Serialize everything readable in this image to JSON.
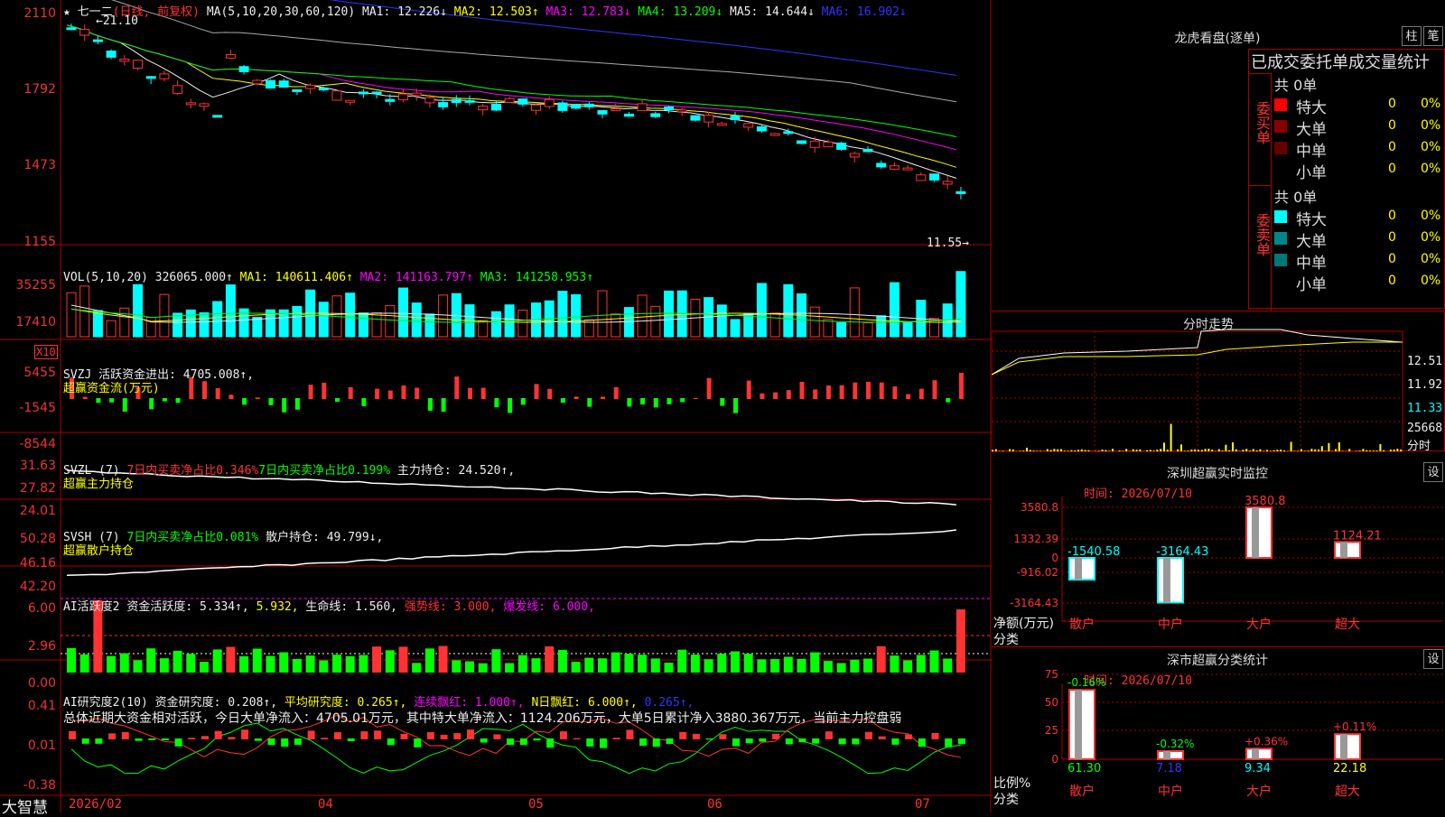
{
  "app": {
    "brand": "大智慧"
  },
  "main": {
    "title": "七一二",
    "period": "(日线, 前复权)",
    "ma_label": "MA(5,10,20,30,60,120)",
    "ma1": "MA1: 12.226↓",
    "ma2": "MA2: 12.503↑",
    "ma3": "MA3: 12.783↓",
    "ma4": "MA4: 13.209↓",
    "ma5": "MA5: 14.644↓",
    "ma6": "MA6: 16.902↓",
    "y_ticks": [
      "2110",
      "1792",
      "1473",
      "1155"
    ],
    "high_label": "21.10",
    "low_label": "11.55"
  },
  "vol": {
    "label": "VOL(5,10,20)",
    "value": "326065.000↑",
    "ma1": "MA1: 140611.406↑",
    "ma2": "MA2: 141163.797↑",
    "ma3": "MA3: 141258.953↑",
    "y_ticks": [
      "35255",
      "17410"
    ],
    "unit": "X10"
  },
  "svzj": {
    "label": "SVZJ",
    "line": "活跃资金进出: 4705.008↑,",
    "sub": "超赢资金流(万元)",
    "y_ticks": [
      "5455",
      "-1545",
      "-8544"
    ]
  },
  "svzl": {
    "label": "SVZL (7)",
    "a": "7日内买卖净占比0.346%",
    "b": "7日内买卖净占比0.199%",
    "c": "主力持仓: 24.520↑,",
    "sub": "超赢主力持仓",
    "y_ticks": [
      "31.63",
      "27.82",
      "24.01"
    ]
  },
  "svsh": {
    "label": "SVSH (7)",
    "a": "7日内买卖净占比0.081%",
    "c": "散户持仓: 49.799↓,",
    "sub": "超赢散户持仓",
    "y_ticks": [
      "50.28",
      "46.16",
      "42.20"
    ]
  },
  "ai1": {
    "label": "AI活跃度2",
    "a": "资金活跃度: 5.334↑,",
    "b": "5.932,",
    "c": "生命线: 1.560,",
    "d": "强势线: 3.000,",
    "e": "爆发线: 6.000,",
    "y_ticks": [
      "6.00",
      "2.96",
      "0.00"
    ]
  },
  "ai2": {
    "label": "AI研究度2(10)",
    "a": "资金研究度: 0.208↑,",
    "b": "平均研究度: 0.265↑,",
    "c": "连续飘红: 1.000↑,",
    "d": "N日飘红: 6.000↑,",
    "e": "0.265↑,",
    "summary": "总体近期大资金相对活跃，今日大单净流入：4705.01万元，其中特大单净流入：1124.206万元，大单5日累计净入3880.367万元，当前主力控盘弱",
    "y_ticks": [
      "0.41",
      "0.01",
      "-0.38"
    ]
  },
  "x_axis": [
    "2026/02",
    "04",
    "05",
    "06",
    "07"
  ],
  "dragon": {
    "title": "龙虎看盘(逐单)",
    "btn1": "柱",
    "btn2": "笔",
    "header": "已成交委托单成交量统计",
    "buy": {
      "side": "委买单",
      "total": "共 0单",
      "rows": [
        {
          "name": "特大",
          "val": "0",
          "pct": "0%",
          "color": "#f00"
        },
        {
          "name": "大单",
          "val": "0",
          "pct": "0%",
          "color": "#800"
        },
        {
          "name": "中单",
          "val": "0",
          "pct": "0%",
          "color": "#600"
        },
        {
          "name": "小单",
          "val": "0",
          "pct": "0%",
          "color": "#000"
        }
      ]
    },
    "sell": {
      "side": "委卖单",
      "total": "共 0单",
      "rows": [
        {
          "name": "特大",
          "val": "0",
          "pct": "0%",
          "color": "#0ff"
        },
        {
          "name": "大单",
          "val": "0",
          "pct": "0%",
          "color": "#088"
        },
        {
          "name": "中单",
          "val": "0",
          "pct": "0%",
          "color": "#077"
        },
        {
          "name": "小单",
          "val": "0",
          "pct": "0%",
          "color": "#000"
        }
      ]
    }
  },
  "intraday": {
    "title": "分时走势",
    "prices": [
      "12.51",
      "11.92",
      "11.33"
    ],
    "vol": "25668",
    "unit": "分时"
  },
  "sz_monitor": {
    "title": "深圳超赢实时监控",
    "btn": "设",
    "time": "时间: 2026/07/10",
    "y_ticks": [
      "3580.8",
      "1332.39",
      "0",
      "-916.02",
      "-3164.43"
    ],
    "bars": [
      {
        "cat": "散户",
        "value": -1540.58,
        "label": "-1540.58"
      },
      {
        "cat": "中户",
        "value": -3164.43,
        "label": "-3164.43"
      },
      {
        "cat": "大户",
        "value": 3580.8,
        "label": "3580.8"
      },
      {
        "cat": "超大",
        "value": 1124.21,
        "label": "1124.21"
      }
    ],
    "ylabel": "净额(万元)",
    "xlabel": "分类"
  },
  "sz_class": {
    "title": "深市超赢分类统计",
    "btn": "设",
    "time": "时间: 2026/07/10",
    "y_ticks": [
      "75",
      "50",
      "25",
      "0"
    ],
    "bars": [
      {
        "cat": "散户",
        "value": 61.3,
        "label": "61.30",
        "delta": "-0.16%"
      },
      {
        "cat": "中户",
        "value": 7.18,
        "label": "7.18",
        "delta": "-0.32%"
      },
      {
        "cat": "大户",
        "value": 9.34,
        "label": "9.34",
        "delta": "+0.36%"
      },
      {
        "cat": "超大",
        "value": 22.18,
        "label": "22.18",
        "delta": "+0.11%"
      }
    ],
    "ylabel": "比例%",
    "xlabel": "分类"
  },
  "chart_data": [
    {
      "type": "bar",
      "title": "深圳超赢实时监控",
      "categories": [
        "散户",
        "中户",
        "大户",
        "超大"
      ],
      "values": [
        -1540.58,
        -3164.43,
        3580.8,
        1124.21
      ],
      "ylabel": "净额(万元)",
      "xlabel": "分类"
    },
    {
      "type": "bar",
      "title": "深市超赢分类统计",
      "categories": [
        "散户",
        "中户",
        "大户",
        "超大"
      ],
      "values": [
        61.3,
        7.18,
        9.34,
        22.18
      ],
      "ylabel": "比例%",
      "xlabel": "分类",
      "ylim": [
        0,
        75
      ]
    }
  ]
}
